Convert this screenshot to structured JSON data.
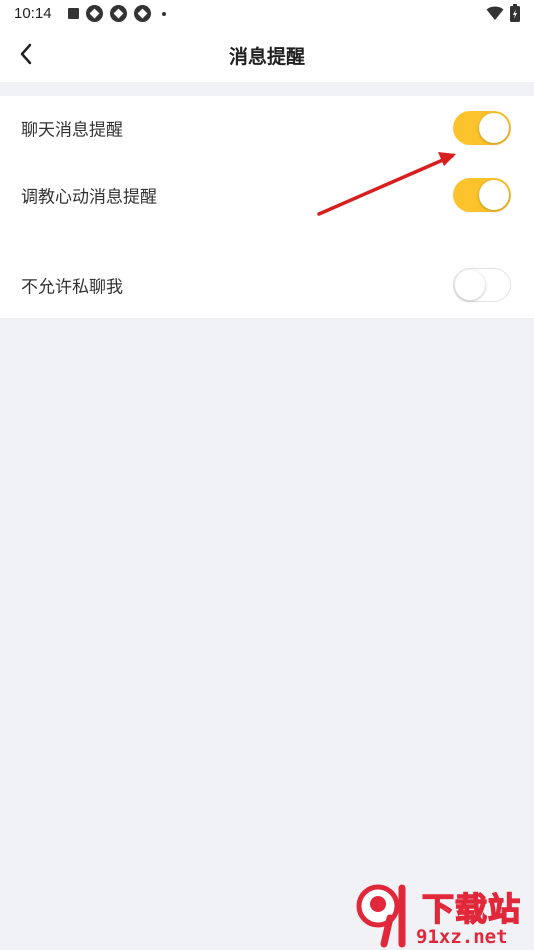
{
  "status_bar": {
    "time": "10:14"
  },
  "header": {
    "title": "消息提醒",
    "back_icon": "chevron-left-icon"
  },
  "settings": {
    "items": [
      {
        "label": "聊天消息提醒",
        "enabled": true
      },
      {
        "label": "调教心动消息提醒",
        "enabled": true
      },
      {
        "label": "不允许私聊我",
        "enabled": false
      }
    ]
  },
  "colors": {
    "toggle_on": "#fcc32c",
    "annotation_arrow": "#d81e1e",
    "page_background": "#f1f2f6"
  },
  "watermark": {
    "brand": "下载站",
    "domain": "91xz.net"
  }
}
